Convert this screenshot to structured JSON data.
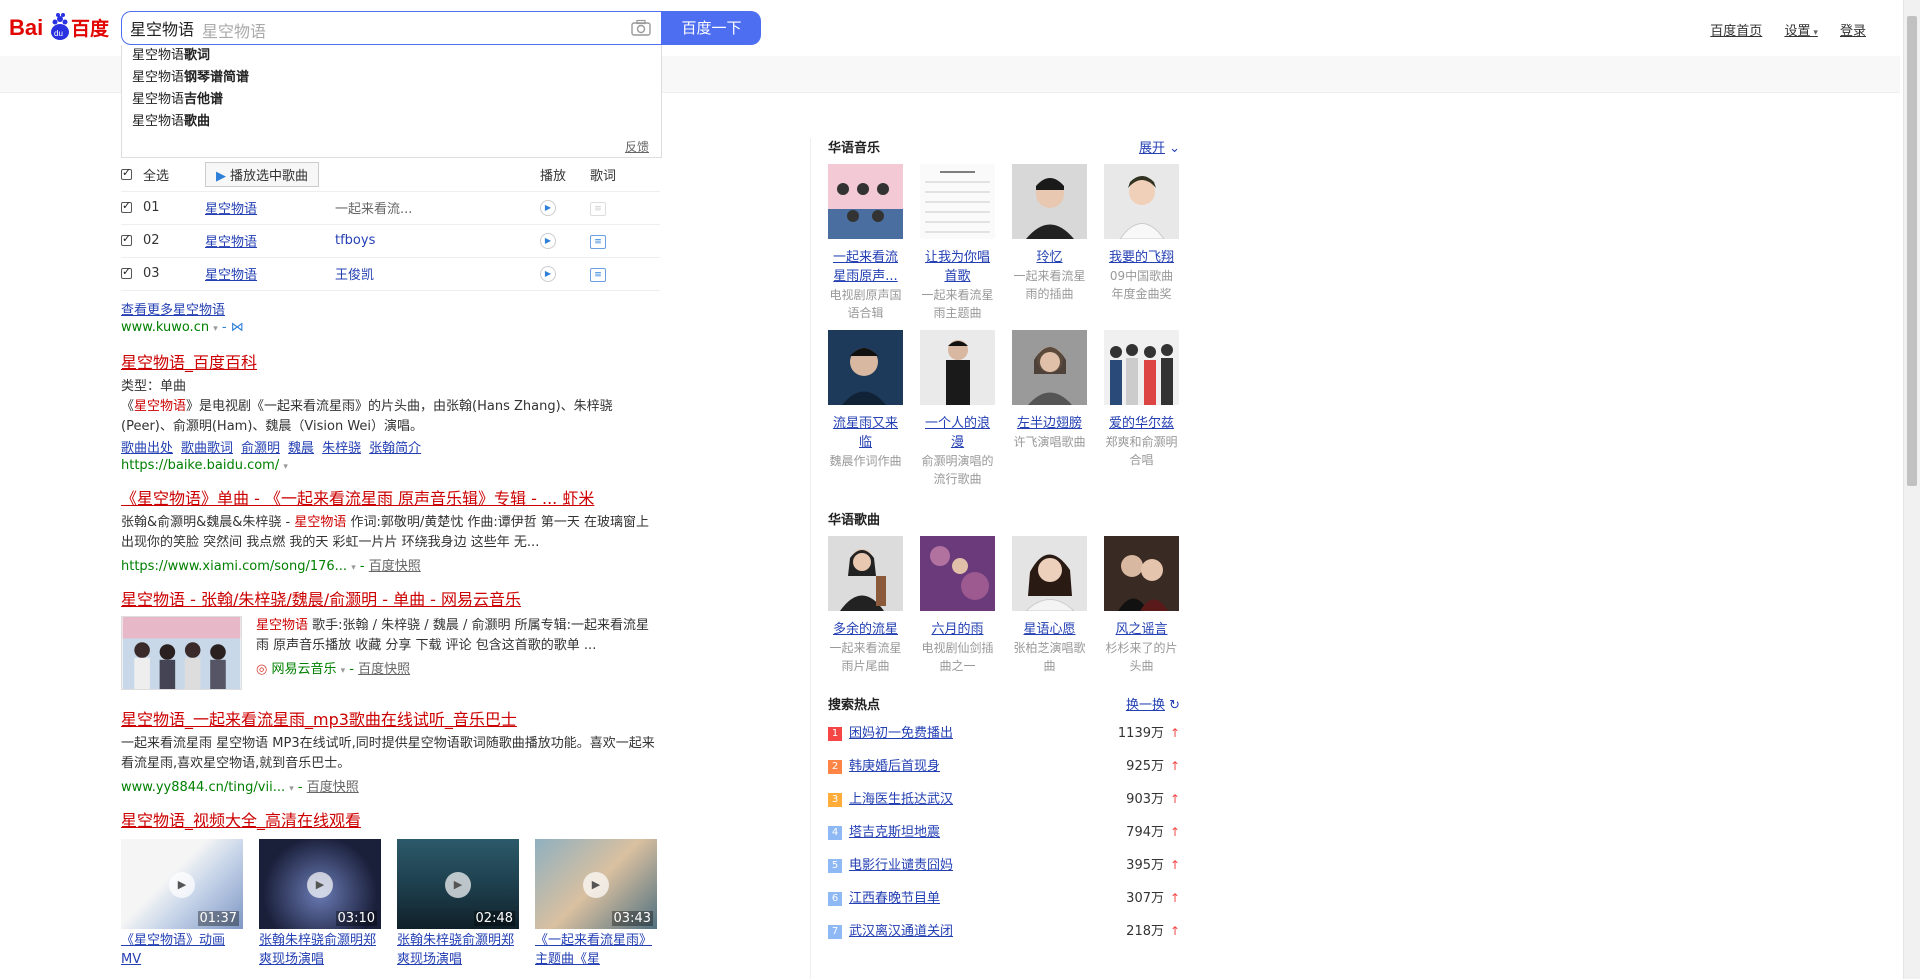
{
  "logo": {
    "text": "Bai百度"
  },
  "search": {
    "value": "星空物语",
    "placeholder": "星空物语",
    "button": "百度一下"
  },
  "top_links": [
    "百度首页",
    "设置",
    "登录"
  ],
  "suggestions": [
    {
      "prefix": "星空物语",
      "suffix": "歌词"
    },
    {
      "prefix": "星空物语",
      "suffix": "钢琴谱简谱"
    },
    {
      "prefix": "星空物语",
      "suffix": "吉他谱"
    },
    {
      "prefix": "星空物语",
      "suffix": "歌曲"
    }
  ],
  "suggest_feedback": "反馈",
  "music": {
    "select_all": "全选",
    "play_selected": "播放选中歌曲",
    "col_play": "播放",
    "col_lyrics": "歌词",
    "rows": [
      {
        "num": "01",
        "song": "星空物语",
        "artist": "一起来看流..."
      },
      {
        "num": "02",
        "song": "星空物语",
        "artist": "tfboys"
      },
      {
        "num": "03",
        "song": "星空物语",
        "artist": "王俊凯"
      }
    ],
    "more_link": "查看更多星空物语",
    "source": "www.kuwo.cn"
  },
  "r1": {
    "title": "星空物语_百度百科",
    "type_line": "类型：单曲",
    "abs_pre": "《",
    "abs_hl": "星空物语",
    "abs_post": "》是电视剧《一起来看流星雨》的片头曲，由张翰(Hans Zhang)、朱梓骁(Peer)、俞灏明(Ham)、魏晨（Vision Wei）演唱。",
    "sublinks": [
      "歌曲出处",
      "歌曲歌词",
      "俞灏明",
      "魏晨",
      "朱梓骁",
      "张翰简介"
    ],
    "url": "https://baike.baidu.com/"
  },
  "r2": {
    "title": "《星空物语》单曲 - 《一起来看流星雨 原声音乐辑》专辑 - ... 虾米",
    "abs_pre": "张翰&俞灏明&魏晨&朱梓骁 - ",
    "abs_hl": "星空物语",
    "abs_post": " 作词:郭敬明/黄楚忱 作曲:谭伊哲 第一天 在玻璃窗上出现你的笑脸 突然间 我点燃 我的天 彩虹一片片 环绕我身边 这些年 无...",
    "url": "https://www.xiami.com/song/176...",
    "snapshot": "百度快照"
  },
  "r3": {
    "title": "星空物语 - 张翰/朱梓骁/魏晨/俞灏明 - 单曲 - 网易云音乐",
    "abs_hl": "星空物语",
    "abs_post": " 歌手:张翰 / 朱梓骁 / 魏晨 / 俞灏明 所属专辑:一起来看流星雨 原声音乐播放 收藏 分享 下载 评论 包含这首歌的歌单 ...",
    "source": "网易云音乐",
    "snapshot": "百度快照"
  },
  "r4": {
    "title": "星空物语_一起来看流星雨_mp3歌曲在线试听_音乐巴士",
    "abs": "一起来看流星雨 星空物语 MP3在线试听,同时提供星空物语歌词随歌曲播放功能。喜欢一起来看流星雨,喜欢星空物语,就到音乐巴士。",
    "url": "www.yy8844.cn/ting/vii...",
    "snapshot": "百度快照"
  },
  "r5": {
    "title": "星空物语_视频大全_高清在线观看",
    "videos": [
      {
        "dur": "01:37",
        "title": "《星空物语》动画MV"
      },
      {
        "dur": "03:10",
        "title": "张翰朱梓骁俞灏明郑爽现场演唱"
      },
      {
        "dur": "02:48",
        "title": "张翰朱梓骁俞灏明郑爽现场演唱"
      },
      {
        "dur": "03:43",
        "title": "《一起来看流星雨》主题曲《星"
      }
    ]
  },
  "right": {
    "music_head": "华语音乐",
    "expand": "展开",
    "music_row1": [
      {
        "name": "一起来看流星雨原声...",
        "desc": "电视剧原声国语合辑"
      },
      {
        "name": "让我为你唱首歌",
        "desc": "一起来看流星雨主题曲"
      },
      {
        "name": "玲忆",
        "desc": "一起来看流星雨的插曲"
      },
      {
        "name": "我要的飞翔",
        "desc": "09中国歌曲年度金曲奖"
      }
    ],
    "music_row2": [
      {
        "name": "流星雨又来临",
        "desc": "魏晨作词作曲"
      },
      {
        "name": "一个人的浪漫",
        "desc": "俞灏明演唱的流行歌曲"
      },
      {
        "name": "左半边翅膀",
        "desc": "许飞演唱歌曲"
      },
      {
        "name": "爱的华尔兹",
        "desc": "郑爽和俞灏明合唱"
      }
    ],
    "songs_head": "华语歌曲",
    "songs": [
      {
        "name": "多余的流星",
        "desc": "一起来看流星雨片尾曲"
      },
      {
        "name": "六月的雨",
        "desc": "电视剧仙剑插曲之一"
      },
      {
        "name": "星语心愿",
        "desc": "张柏芝演唱歌曲"
      },
      {
        "name": "风之谣言",
        "desc": "杉杉来了的片头曲"
      }
    ],
    "hot_head": "搜索热点",
    "hot_refresh": "换一换",
    "hot": [
      {
        "rank": "1",
        "title": "困妈初一免费播出",
        "count": "1139万",
        "color": "#f54545"
      },
      {
        "rank": "2",
        "title": "韩庚婚后首现身",
        "count": "925万",
        "color": "#ff8547"
      },
      {
        "rank": "3",
        "title": "上海医生抵达武汉",
        "count": "903万",
        "color": "#ffac38"
      },
      {
        "rank": "4",
        "title": "塔吉克斯坦地震",
        "count": "794万",
        "color": "#8eb9f5"
      },
      {
        "rank": "5",
        "title": "电影行业谴责囧妈",
        "count": "395万",
        "color": "#8eb9f5"
      },
      {
        "rank": "6",
        "title": "江西春晚节目单",
        "count": "307万",
        "color": "#8eb9f5"
      },
      {
        "rank": "7",
        "title": "武汉离汉通道关闭",
        "count": "218万",
        "color": "#8eb9f5"
      }
    ]
  }
}
